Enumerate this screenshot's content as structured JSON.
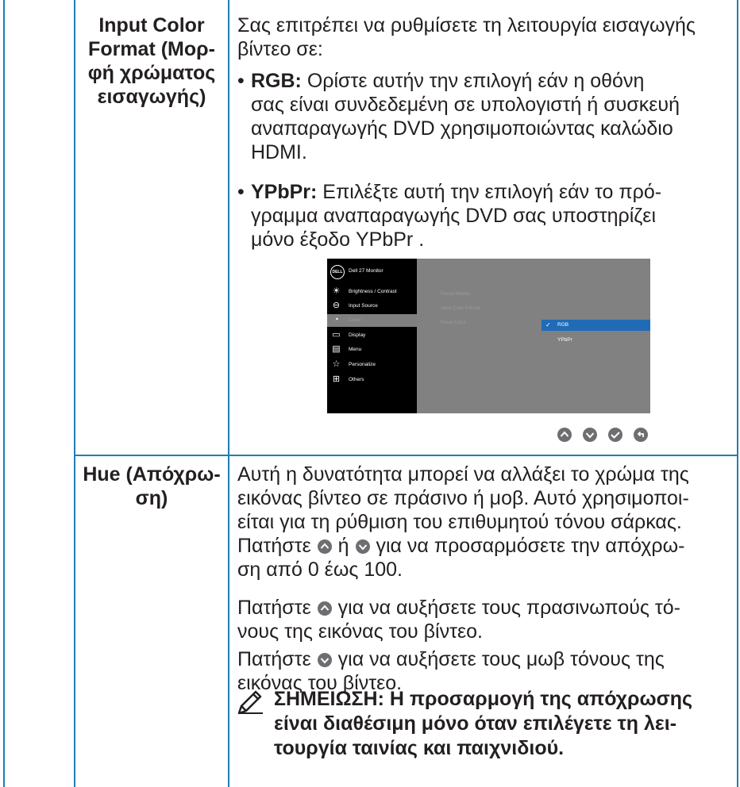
{
  "row1": {
    "label_lines": [
      "Input Color",
      "Format (Μορ-",
      "φή χρώματος",
      "εισαγωγής)"
    ],
    "intro_lines": [
      "Σας επιτρέπει να ρυθμίσετε τη λειτουργία εισαγωγής",
      "βίντεο σε:"
    ],
    "bullet1": {
      "term": "RGB:",
      "first": " Ορίστε αυτήν την επιλογή εάν η οθόνη",
      "rest": [
        "σας είναι συνδεδεμένη σε υπολογιστή ή συσκευή",
        "αναπαραγωγής DVD χρησιμοποιώντας καλώδιο",
        "HDMI."
      ]
    },
    "bullet2": {
      "term": "YPbPr:",
      "first": " Επιλέξτε αυτή την επιλογή εάν το πρό-",
      "rest": [
        "γραμμα αναπαραγωγής DVD σας υποστηρίζει",
        "μόνο έξοδο YPbPr ."
      ]
    }
  },
  "osd": {
    "logo": "DELL",
    "title": "Dell 27 Monitor",
    "menu": [
      {
        "icon": "brightness-icon",
        "label": "Brightness / Contrast"
      },
      {
        "icon": "input-source-icon",
        "label": "Input Source"
      },
      {
        "icon": "color-icon",
        "label": "Color"
      },
      {
        "icon": "display-icon",
        "label": "Display"
      },
      {
        "icon": "menu-icon",
        "label": "Menu"
      },
      {
        "icon": "personalize-icon",
        "label": "Personalize"
      },
      {
        "icon": "others-icon",
        "label": "Others"
      }
    ],
    "middle": [
      "Preset Modes",
      "Input Color Format",
      "Reset Color"
    ],
    "options": [
      "RGB",
      "YPbPr"
    ],
    "selected_color": "#1f6bb6"
  },
  "row2": {
    "label_lines": [
      "Hue (Απόχρω-",
      "ση)"
    ],
    "p1_lines": [
      "Αυτή η δυνατότητα μπορεί να αλλάξει το χρώμα της",
      "εικόνας βίντεο σε πράσινο ή μοβ. Αυτό χρησιμοποι-",
      "είται για τη ρύθμιση του επιθυμητού τόνου σάρκας."
    ],
    "p1_l4_a": "Πατήστε",
    "p1_l4_b": "ή",
    "p1_l4_c": "για να προσαρμόσετε την απόχρω-",
    "p1_l5": "ση από 0 έως 100.",
    "p2_a": "Πατήστε",
    "p2_b": "για να αυξήσετε τους πρασινωπούς τό-",
    "p2_c": "νους της εικόνας του βίντεο.",
    "p3_a": "Πατήστε",
    "p3_b": "για να αυξήσετε τους μωβ τόνους της",
    "p3_c": "εικόνας του βίντεο.",
    "note_lines": [
      "ΣΗΜΕΙΩΣΗ: Η προσαρμογή της απόχρωσης",
      "είναι διαθέσιμη μόνο όταν επιλέγετε τη λει-",
      "τουργία ταινίας και παιχνιδιού."
    ]
  },
  "colors": {
    "rule": "#1f7fb0",
    "button": "#6d6e71"
  }
}
